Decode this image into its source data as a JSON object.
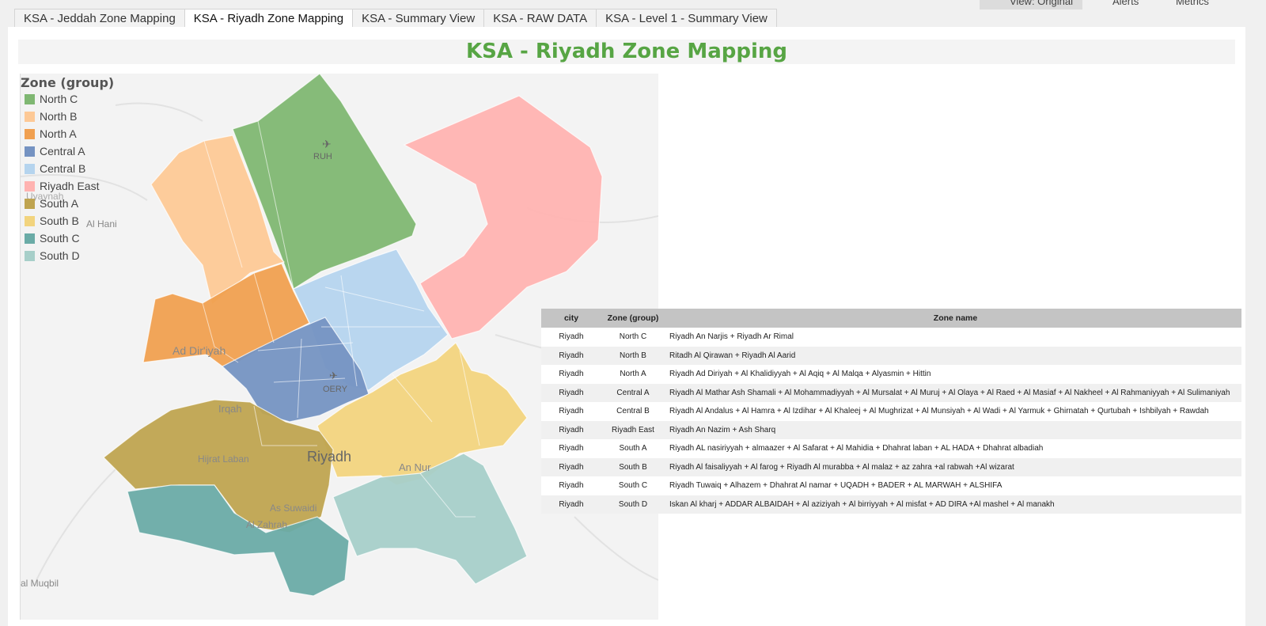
{
  "topbar": {
    "view_label": "View: Original",
    "alerts_label": "Alerts",
    "metrics_label": "Metrics"
  },
  "tabs": [
    {
      "label": "KSA - Jeddah Zone Mapping",
      "active": false
    },
    {
      "label": "KSA - Riyadh Zone Mapping",
      "active": true
    },
    {
      "label": "KSA - Summary View",
      "active": false
    },
    {
      "label": "KSA - RAW DATA",
      "active": false
    },
    {
      "label": "KSA - Level 1 - Summary View",
      "active": false
    }
  ],
  "dashboard": {
    "title": "KSA - Riyadh Zone Mapping"
  },
  "legend": {
    "title": "Zone  (group)",
    "items": [
      {
        "label": "North C",
        "color": "#7fb772"
      },
      {
        "label": "North B",
        "color": "#fdc996"
      },
      {
        "label": "North A",
        "color": "#f0a050"
      },
      {
        "label": "Central A",
        "color": "#7593c2"
      },
      {
        "label": "Central B",
        "color": "#b5d4ee"
      },
      {
        "label": "Riyadh East",
        "color": "#ffb3b1"
      },
      {
        "label": "South A",
        "color": "#bfa450"
      },
      {
        "label": "South B",
        "color": "#f2d47e"
      },
      {
        "label": "South C",
        "color": "#6aaba6"
      },
      {
        "label": "South D",
        "color": "#a7cfc9"
      }
    ]
  },
  "map": {
    "places": {
      "ruh": "RUH",
      "oery": "OERY",
      "al_hani": "Al Hani",
      "ad_diriyah": "Ad Dir'iyah",
      "irqah": "Irqah",
      "hijrat_laban": "Hijrat Laban",
      "riyadh": "Riyadh",
      "an_nur": "An Nur",
      "as_suwaidi": "As Suwaidi",
      "al_zahrah": "Al Zahrah",
      "al_muqbil": "al Muqbil",
      "uyayna": "Uyaynah"
    }
  },
  "table": {
    "headers": {
      "city": "city",
      "zone": "Zone  (group)",
      "name": "Zone name"
    },
    "rows": [
      {
        "city": "Riyadh",
        "zone": "North C",
        "name": "Riyadh An Narjis + Riyadh Ar Rimal"
      },
      {
        "city": "Riyadh",
        "zone": "North B",
        "name": "Ritadh Al Qirawan + Riyadh Al Aarid"
      },
      {
        "city": "Riyadh",
        "zone": "North A",
        "name": "Riyadh Ad Diriyah + Al Khalidiyyah +  Al Aqiq + Al Malqa + Alyasmin + Hittin"
      },
      {
        "city": "Riyadh",
        "zone": "Central A",
        "name": "Riyadh Al Mathar Ash Shamali + Al Mohammadiyyah + Al Mursalat + Al Muruj + Al Olaya + Al Raed + Al Masiaf + Al Nakheel + Al Rahmaniyyah + Al Sulimaniyah"
      },
      {
        "city": "Riyadh",
        "zone": "Central B",
        "name": "Riyadh Al Andalus + Al Hamra + Al Izdihar + Al Khaleej + Al Mughrizat + Al Munsiyah + Al Wadi + Al Yarmuk + Ghirnatah + Qurtubah + Ishbilyah + Rawdah"
      },
      {
        "city": "Riyadh",
        "zone": "Riyadh East",
        "name": "Riyadh An Nazim + Ash Sharq"
      },
      {
        "city": "Riyadh",
        "zone": "South A",
        "name": "Riyadh AL nasiriyyah + almaazer +  Al Safarat + Al Mahidia + Dhahrat laban + AL HADA +  Dhahrat albadiah"
      },
      {
        "city": "Riyadh",
        "zone": "South B",
        "name": "Riyadh Al faisaliyyah + Al farog + Riyadh Al murabba + Al malaz + az zahra +al rabwah +Al wizarat"
      },
      {
        "city": "Riyadh",
        "zone": "South C",
        "name": "Riyadh Tuwaiq + Alhazem + Dhahrat Al namar +  UQADH + BADER + AL MARWAH + ALSHIFA"
      },
      {
        "city": "Riyadh",
        "zone": "South D",
        "name": "Iskan Al kharj +  ADDAR ALBAIDAH + Al aziziyah +   Al birriyyah + Al misfat + AD DIRA +Al mashel + Al manakh"
      }
    ]
  }
}
